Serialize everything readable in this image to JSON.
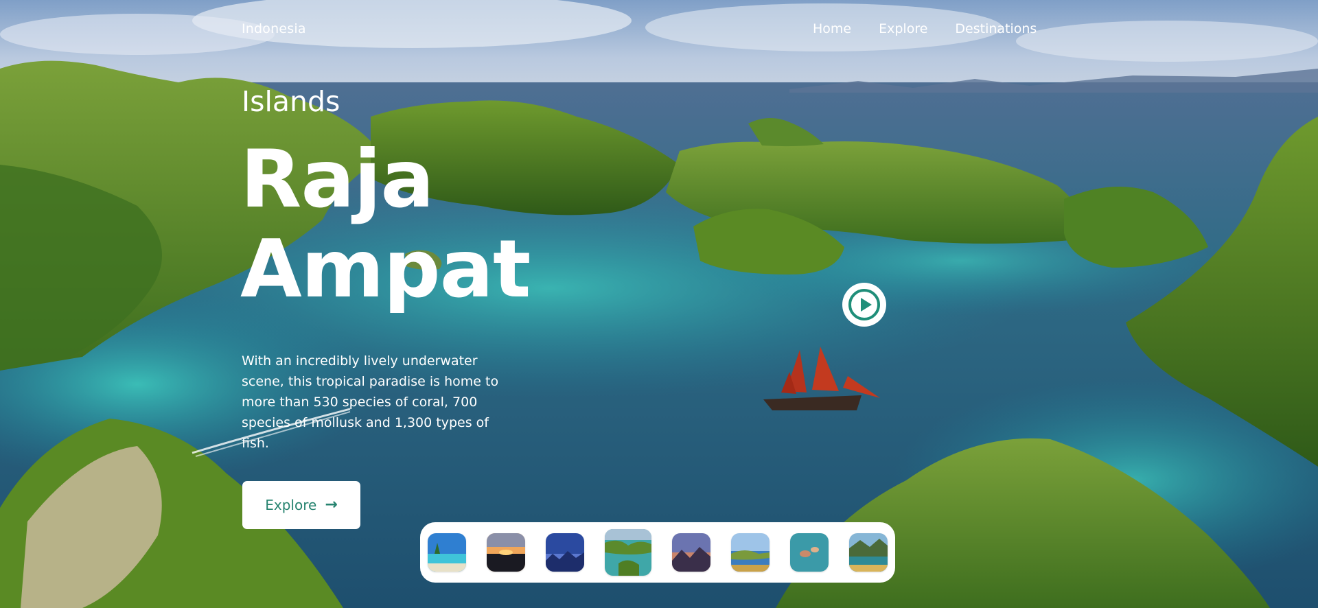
{
  "header": {
    "brand": "Indonesia",
    "nav": [
      "Home",
      "Explore",
      "Destinations"
    ]
  },
  "hero": {
    "kicker": "Islands",
    "title_line1": "Raja",
    "title_line2": "Ampat",
    "description": "With an incredibly lively underwater scene, this tropical paradise is home to more than 530 species of coral, 700 species of mollusk and 1,300 types of fish.",
    "explore_label": "Explore"
  },
  "icons": {
    "play": "play-circle-icon",
    "arrow": "arrow-right-icon"
  },
  "thumbnails": [
    {
      "scene": "beach",
      "active": false
    },
    {
      "scene": "sunset",
      "active": false
    },
    {
      "scene": "night-city",
      "active": false
    },
    {
      "scene": "raja-ampat",
      "active": true
    },
    {
      "scene": "mountain-dusk",
      "active": false
    },
    {
      "scene": "lake",
      "active": false
    },
    {
      "scene": "snorkel",
      "active": false
    },
    {
      "scene": "lagoon",
      "active": false
    }
  ],
  "colors": {
    "accent": "#26836f",
    "strip_bg": "#ffffff",
    "text": "#ffffff"
  }
}
